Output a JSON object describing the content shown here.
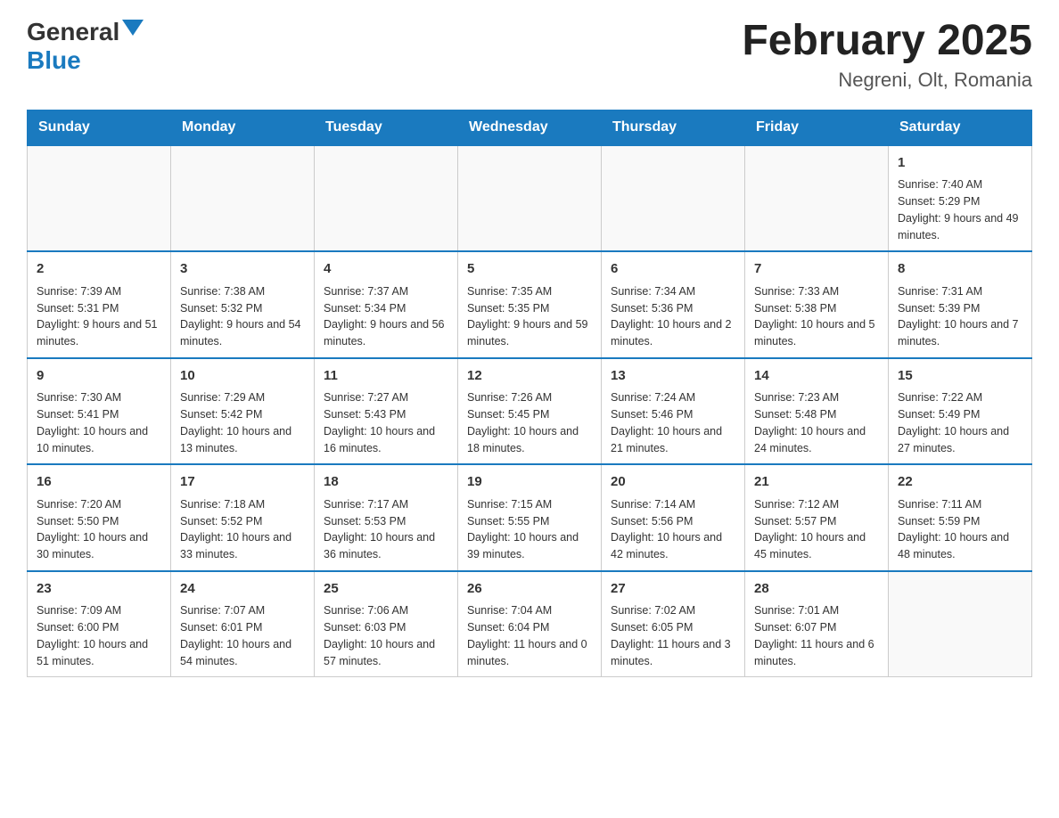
{
  "header": {
    "logo_text_general": "General",
    "logo_text_blue": "Blue",
    "title": "February 2025",
    "subtitle": "Negreni, Olt, Romania"
  },
  "weekdays": [
    "Sunday",
    "Monday",
    "Tuesday",
    "Wednesday",
    "Thursday",
    "Friday",
    "Saturday"
  ],
  "weeks": [
    [
      {
        "day": "",
        "info": ""
      },
      {
        "day": "",
        "info": ""
      },
      {
        "day": "",
        "info": ""
      },
      {
        "day": "",
        "info": ""
      },
      {
        "day": "",
        "info": ""
      },
      {
        "day": "",
        "info": ""
      },
      {
        "day": "1",
        "info": "Sunrise: 7:40 AM\nSunset: 5:29 PM\nDaylight: 9 hours and 49 minutes."
      }
    ],
    [
      {
        "day": "2",
        "info": "Sunrise: 7:39 AM\nSunset: 5:31 PM\nDaylight: 9 hours and 51 minutes."
      },
      {
        "day": "3",
        "info": "Sunrise: 7:38 AM\nSunset: 5:32 PM\nDaylight: 9 hours and 54 minutes."
      },
      {
        "day": "4",
        "info": "Sunrise: 7:37 AM\nSunset: 5:34 PM\nDaylight: 9 hours and 56 minutes."
      },
      {
        "day": "5",
        "info": "Sunrise: 7:35 AM\nSunset: 5:35 PM\nDaylight: 9 hours and 59 minutes."
      },
      {
        "day": "6",
        "info": "Sunrise: 7:34 AM\nSunset: 5:36 PM\nDaylight: 10 hours and 2 minutes."
      },
      {
        "day": "7",
        "info": "Sunrise: 7:33 AM\nSunset: 5:38 PM\nDaylight: 10 hours and 5 minutes."
      },
      {
        "day": "8",
        "info": "Sunrise: 7:31 AM\nSunset: 5:39 PM\nDaylight: 10 hours and 7 minutes."
      }
    ],
    [
      {
        "day": "9",
        "info": "Sunrise: 7:30 AM\nSunset: 5:41 PM\nDaylight: 10 hours and 10 minutes."
      },
      {
        "day": "10",
        "info": "Sunrise: 7:29 AM\nSunset: 5:42 PM\nDaylight: 10 hours and 13 minutes."
      },
      {
        "day": "11",
        "info": "Sunrise: 7:27 AM\nSunset: 5:43 PM\nDaylight: 10 hours and 16 minutes."
      },
      {
        "day": "12",
        "info": "Sunrise: 7:26 AM\nSunset: 5:45 PM\nDaylight: 10 hours and 18 minutes."
      },
      {
        "day": "13",
        "info": "Sunrise: 7:24 AM\nSunset: 5:46 PM\nDaylight: 10 hours and 21 minutes."
      },
      {
        "day": "14",
        "info": "Sunrise: 7:23 AM\nSunset: 5:48 PM\nDaylight: 10 hours and 24 minutes."
      },
      {
        "day": "15",
        "info": "Sunrise: 7:22 AM\nSunset: 5:49 PM\nDaylight: 10 hours and 27 minutes."
      }
    ],
    [
      {
        "day": "16",
        "info": "Sunrise: 7:20 AM\nSunset: 5:50 PM\nDaylight: 10 hours and 30 minutes."
      },
      {
        "day": "17",
        "info": "Sunrise: 7:18 AM\nSunset: 5:52 PM\nDaylight: 10 hours and 33 minutes."
      },
      {
        "day": "18",
        "info": "Sunrise: 7:17 AM\nSunset: 5:53 PM\nDaylight: 10 hours and 36 minutes."
      },
      {
        "day": "19",
        "info": "Sunrise: 7:15 AM\nSunset: 5:55 PM\nDaylight: 10 hours and 39 minutes."
      },
      {
        "day": "20",
        "info": "Sunrise: 7:14 AM\nSunset: 5:56 PM\nDaylight: 10 hours and 42 minutes."
      },
      {
        "day": "21",
        "info": "Sunrise: 7:12 AM\nSunset: 5:57 PM\nDaylight: 10 hours and 45 minutes."
      },
      {
        "day": "22",
        "info": "Sunrise: 7:11 AM\nSunset: 5:59 PM\nDaylight: 10 hours and 48 minutes."
      }
    ],
    [
      {
        "day": "23",
        "info": "Sunrise: 7:09 AM\nSunset: 6:00 PM\nDaylight: 10 hours and 51 minutes."
      },
      {
        "day": "24",
        "info": "Sunrise: 7:07 AM\nSunset: 6:01 PM\nDaylight: 10 hours and 54 minutes."
      },
      {
        "day": "25",
        "info": "Sunrise: 7:06 AM\nSunset: 6:03 PM\nDaylight: 10 hours and 57 minutes."
      },
      {
        "day": "26",
        "info": "Sunrise: 7:04 AM\nSunset: 6:04 PM\nDaylight: 11 hours and 0 minutes."
      },
      {
        "day": "27",
        "info": "Sunrise: 7:02 AM\nSunset: 6:05 PM\nDaylight: 11 hours and 3 minutes."
      },
      {
        "day": "28",
        "info": "Sunrise: 7:01 AM\nSunset: 6:07 PM\nDaylight: 11 hours and 6 minutes."
      },
      {
        "day": "",
        "info": ""
      }
    ]
  ]
}
